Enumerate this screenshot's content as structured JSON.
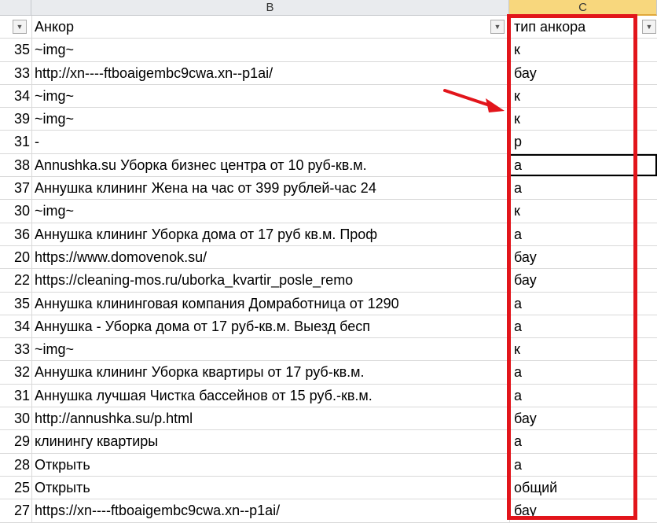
{
  "columns": {
    "b": "B",
    "c": "C"
  },
  "header": {
    "row_label": "",
    "b": "Анкор",
    "c": "тип анкора"
  },
  "rows": [
    {
      "n": "35",
      "b": "~img~",
      "c": "к"
    },
    {
      "n": "33",
      "b": "http://xn----ftboaigembc9cwa.xn--p1ai/",
      "c": "бау"
    },
    {
      "n": "34",
      "b": "~img~",
      "c": "к"
    },
    {
      "n": "39",
      "b": "~img~",
      "c": "к"
    },
    {
      "n": "31",
      "b": "-",
      "c": "р"
    },
    {
      "n": "38",
      "b": "Annushka.su Уборка бизнес центра от 10 руб-кв.м.",
      "c": "а"
    },
    {
      "n": "37",
      "b": "Аннушка клининг Жена на час от 399 рублей-час 24",
      "c": "а"
    },
    {
      "n": "30",
      "b": "~img~",
      "c": "к"
    },
    {
      "n": "36",
      "b": "Аннушка клининг Уборка дома от 17 руб кв.м. Проф",
      "c": "а"
    },
    {
      "n": "20",
      "b": "https://www.domovenok.su/",
      "c": "бау"
    },
    {
      "n": "22",
      "b": "https://cleaning-mos.ru/uborka_kvartir_posle_remo",
      "c": "бау"
    },
    {
      "n": "35",
      "b": "Аннушка клининговая компания Домработница от 1290",
      "c": "а"
    },
    {
      "n": "34",
      "b": "Аннушка - Уборка дома от 17 руб-кв.м. Выезд бесп",
      "c": "а"
    },
    {
      "n": "33",
      "b": "~img~",
      "c": "к"
    },
    {
      "n": "32",
      "b": "Аннушка клининг Уборка квартиры от 17 руб-кв.м.",
      "c": "а"
    },
    {
      "n": "31",
      "b": "Аннушка лучшая Чистка бассейнов от 15 руб.-кв.м.",
      "c": "а"
    },
    {
      "n": "30",
      "b": "http://annushka.su/p.html",
      "c": "бау"
    },
    {
      "n": "29",
      "b": "клинингу квартиры",
      "c": "а"
    },
    {
      "n": "28",
      "b": "Открыть",
      "c": "а"
    },
    {
      "n": "25",
      "b": "Открыть",
      "c": "общий"
    },
    {
      "n": "27",
      "b": "https://xn----ftboaigembc9cwa.xn--p1ai/",
      "c": "бау"
    }
  ],
  "colors": {
    "highlight": "#e2151b",
    "selected_column": "#f8d77d"
  }
}
